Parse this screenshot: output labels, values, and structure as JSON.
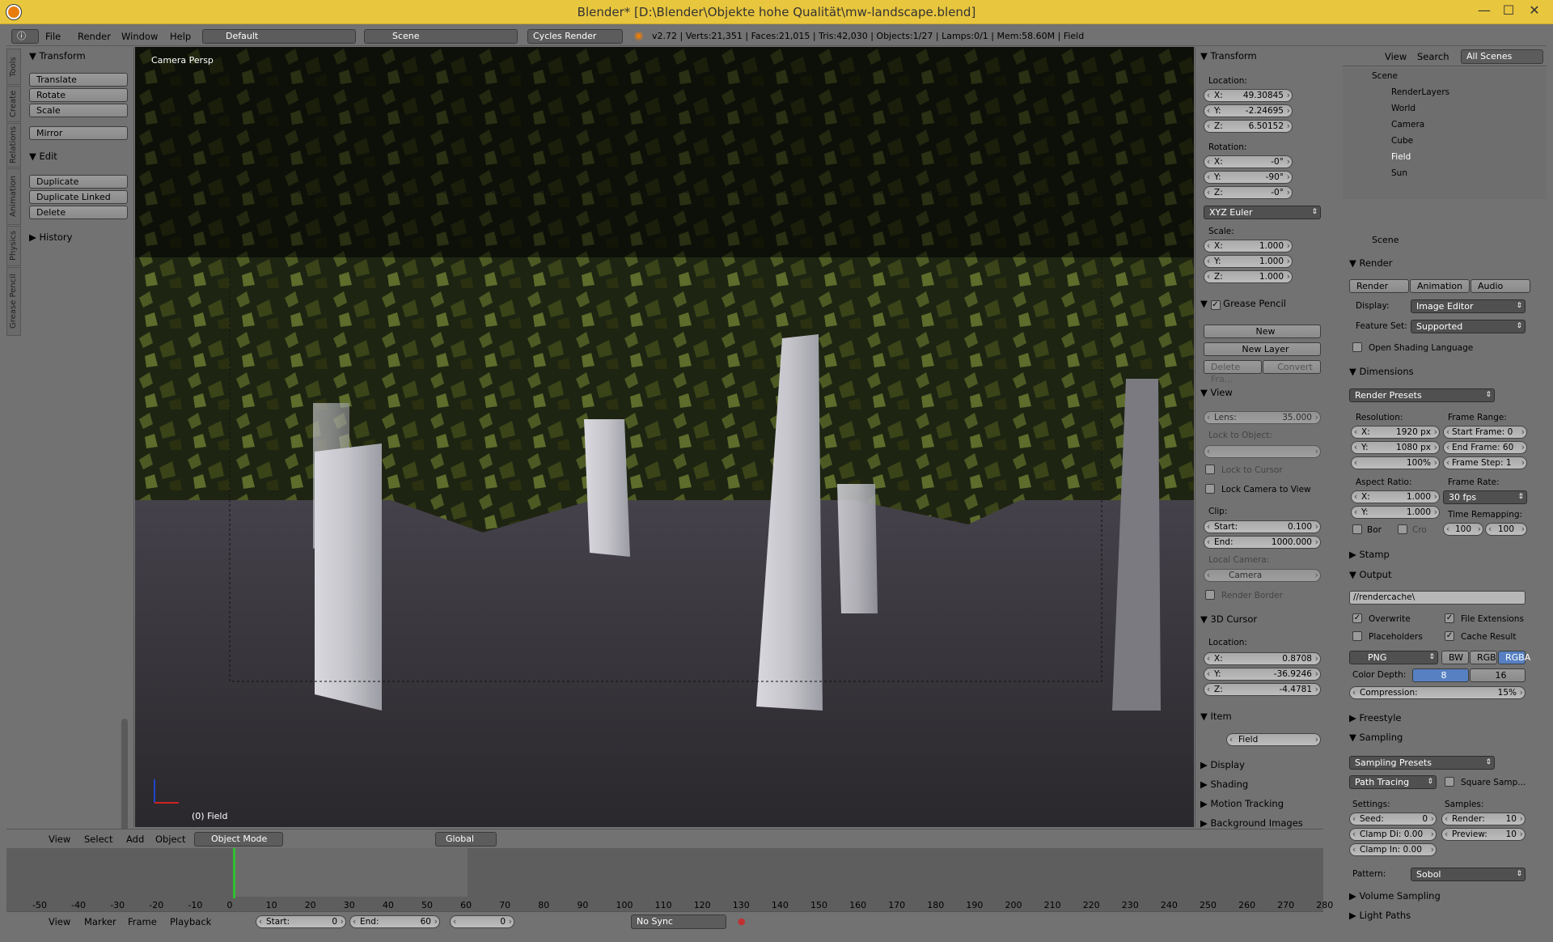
{
  "window": {
    "title": "Blender* [D:\\Blender\\Objekte hohe Qualität\\mw-landscape.blend]",
    "minimize": "—",
    "maximize": "☐",
    "close": "✕"
  },
  "infobar": {
    "menus": [
      "File",
      "Render",
      "Window",
      "Help"
    ],
    "layout": "Default",
    "scene": "Scene",
    "engine": "Cycles Render",
    "stats": "v2.72 | Verts:21,351 | Faces:21,015 | Tris:42,030 | Objects:1/27 | Lamps:0/1 | Mem:58.60M | Field"
  },
  "tools": {
    "transform": "Transform",
    "translate": "Translate",
    "rotate": "Rotate",
    "scale": "Scale",
    "mirror": "Mirror",
    "edit": "Edit",
    "duplicate": "Duplicate",
    "duplicate_linked": "Duplicate Linked",
    "delete": "Delete",
    "history": "History",
    "tabs": [
      "Tools",
      "Create",
      "Relations",
      "Animation",
      "Physics",
      "Grease Pencil"
    ]
  },
  "viewport": {
    "label": "Camera Persp",
    "object": "(0) Field"
  },
  "npanel": {
    "transform": "Transform",
    "location": "Location:",
    "loc": [
      {
        "k": "X:",
        "v": "49.30845"
      },
      {
        "k": "Y:",
        "v": "-2.24695"
      },
      {
        "k": "Z:",
        "v": "6.50152"
      }
    ],
    "rotation": "Rotation:",
    "rot": [
      {
        "k": "X:",
        "v": "-0°"
      },
      {
        "k": "Y:",
        "v": "-90°"
      },
      {
        "k": "Z:",
        "v": "-0°"
      }
    ],
    "euler": "XYZ Euler",
    "scale": "Scale:",
    "scl": [
      {
        "k": "X:",
        "v": "1.000"
      },
      {
        "k": "Y:",
        "v": "1.000"
      },
      {
        "k": "Z:",
        "v": "1.000"
      }
    ],
    "grease": "Grease Pencil",
    "new": "New",
    "new_layer": "New Layer",
    "delete_frame": "Delete Fra...",
    "convert": "Convert",
    "view": "View",
    "lens_k": "Lens:",
    "lens_v": "35.000",
    "lock_obj": "Lock to Object:",
    "lock_cursor": "Lock to Cursor",
    "lock_cam": "Lock Camera to View",
    "clip": "Clip:",
    "clip_start_k": "Start:",
    "clip_start_v": "0.100",
    "clip_end_k": "End:",
    "clip_end_v": "1000.000",
    "local_cam": "Local Camera:",
    "camera": "Camera",
    "render_border": "Render Border",
    "cursor": "3D Cursor",
    "cursor_loc": "Location:",
    "cur": [
      {
        "k": "X:",
        "v": "0.8708"
      },
      {
        "k": "Y:",
        "v": "-36.9246"
      },
      {
        "k": "Z:",
        "v": "-4.4781"
      }
    ],
    "item": "Item",
    "item_name": "Field",
    "display": "Display",
    "shading": "Shading",
    "motion": "Motion Tracking",
    "bg": "Background Images"
  },
  "outliner": {
    "view": "View",
    "search": "Search",
    "all_scenes": "All Scenes",
    "items": [
      "Scene",
      "RenderLayers",
      "World",
      "Camera",
      "Cube",
      "Field",
      "Sun"
    ]
  },
  "props": {
    "scene": "Scene",
    "render": "Render",
    "render_btn": "Render",
    "anim_btn": "Animation",
    "audio_btn": "Audio",
    "display_k": "Display:",
    "display_v": "Image Editor",
    "feature_k": "Feature Set:",
    "feature_v": "Supported",
    "osl": "Open Shading Language",
    "dimensions": "Dimensions",
    "presets": "Render Presets",
    "resolution": "Resolution:",
    "res_x_k": "X:",
    "res_x_v": "1920 px",
    "res_y_k": "Y:",
    "res_y_v": "1080 px",
    "res_pct": "100%",
    "frame_range": "Frame Range:",
    "start_frame": "Start Frame: 0",
    "end_frame": "End Frame: 60",
    "frame_step": "Frame Step: 1",
    "aspect": "Aspect Ratio:",
    "asp_x_k": "X:",
    "asp_x_v": "1.000",
    "asp_y_k": "Y:",
    "asp_y_v": "1.000",
    "frame_rate": "Frame Rate:",
    "fps": "30 fps",
    "remap": "Time Remapping:",
    "remap_a": "100",
    "remap_b": "100",
    "bor": "Bor",
    "cro": "Cro",
    "stamp": "Stamp",
    "output": "Output",
    "path": "//rendercache\\",
    "overwrite": "Overwrite",
    "file_ext": "File Extensions",
    "placeholders": "Placeholders",
    "cache": "Cache Result",
    "png": "PNG",
    "bw": "BW",
    "rgb": "RGB",
    "rgba": "RGBA",
    "depth": "Color Depth:",
    "d8": "8",
    "d16": "16",
    "compression": "Compression:",
    "comp_v": "15%",
    "freestyle": "Freestyle",
    "sampling": "Sampling",
    "samp_presets": "Sampling Presets",
    "path_tracing": "Path Tracing",
    "square": "Square Samp...",
    "settings": "Settings:",
    "samples": "Samples:",
    "seed": "Seed:",
    "seed_v": "0",
    "clamp_di": "Clamp Di: 0.00",
    "clamp_in": "Clamp In: 0.00",
    "render_s": "Render:",
    "render_sv": "10",
    "preview_s": "Preview:",
    "preview_sv": "10",
    "pattern_k": "Pattern:",
    "pattern_v": "Sobol",
    "volume": "Volume Sampling",
    "light": "Light Paths"
  },
  "header3d": {
    "menus": [
      "View",
      "Select",
      "Add",
      "Object"
    ],
    "mode": "Object Mode",
    "orient": "Global"
  },
  "timeline": {
    "ticks": [
      "-50",
      "-40",
      "-30",
      "-20",
      "-10",
      "0",
      "10",
      "20",
      "30",
      "40",
      "50",
      "60",
      "70",
      "80",
      "90",
      "100",
      "110",
      "120",
      "130",
      "140",
      "150",
      "160",
      "170",
      "180",
      "190",
      "200",
      "210",
      "220",
      "230",
      "240",
      "250",
      "260",
      "270",
      "280"
    ],
    "menus": [
      "View",
      "Marker",
      "Frame",
      "Playback"
    ],
    "start_k": "Start:",
    "start_v": "0",
    "end_k": "End:",
    "end_v": "60",
    "current": "0",
    "sync": "No Sync"
  },
  "colors": {
    "accent": "#e87d0d",
    "active": "#5680c2",
    "title": "#e8c63e"
  }
}
